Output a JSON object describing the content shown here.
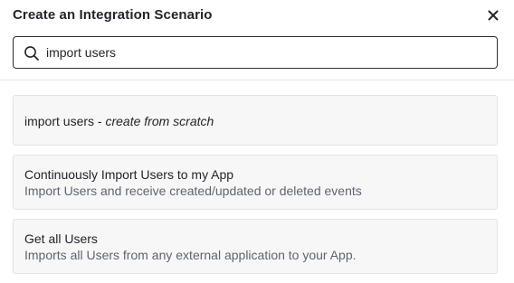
{
  "dialog": {
    "title": "Create an Integration Scenario",
    "close_icon": "close-icon"
  },
  "search": {
    "icon": "search-icon",
    "value": "import users",
    "placeholder": ""
  },
  "results": [
    {
      "query": "import users",
      "separator": " - ",
      "action": "create from scratch"
    },
    {
      "title": "Continuously Import Users to my App",
      "description": "Import Users and receive created/updated or deleted events"
    },
    {
      "title": "Get all Users",
      "description": "Imports all Users from any external application to your App."
    }
  ],
  "colors": {
    "border_dark": "#2b2e33",
    "card_bg": "#f7f7f8",
    "card_border": "#e3e4e7",
    "muted_text": "#5f6570"
  }
}
